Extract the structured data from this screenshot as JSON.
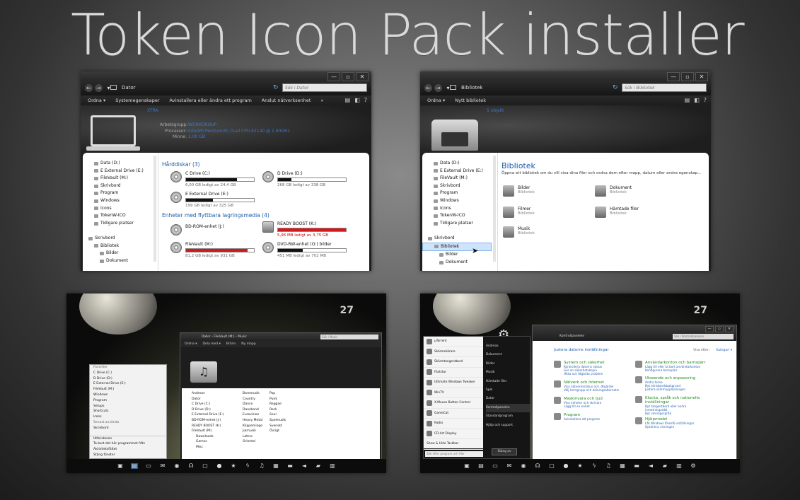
{
  "title": "Token Icon Pack installer",
  "explorer1": {
    "breadcrumb": "Dator",
    "search_placeholder": "Sök i Dator",
    "commands": [
      "Ordna ▾",
      "Systemegenskaper",
      "Avinstallera eller ändra ett program",
      "Anslut nätverksenhet",
      "»"
    ],
    "sys": {
      "computer_name": "XTRA",
      "workgroup_label": "Arbetsgrupp:",
      "workgroup": "WORKGROUP",
      "processor_label": "Processor:",
      "processor": "Intel(R) Pentium(R) Dual  CPU  E2140  @ 1.60GHz",
      "memory_label": "Minne:",
      "memory": "2,00 GB"
    },
    "nav": [
      "Data (D:)",
      "E External Drive (E:)",
      "FileVault (M:)",
      "Skrivbord",
      "Program",
      "Windows",
      "Icons",
      "TokenW-ICO",
      "Tidigare platser",
      "",
      "Skrivbord",
      "Bibliotek",
      "Bilder",
      "Dokument"
    ],
    "hdd_header": "Hårddiskar (3)",
    "removable_header": "Enheter med flyttbara lagringsmedia (4)",
    "drives": [
      {
        "name": "C Drive (C:)",
        "info": "6,00 GB ledigt av 24,4 GB",
        "fill": 0.75
      },
      {
        "name": "D Drive (D:)",
        "info": "268 GB ledigt av 338 GB",
        "fill": 0.2
      },
      {
        "name": "E External Drive (E:)",
        "info": "199 GB ledigt av 325 GB",
        "fill": 0.4
      }
    ],
    "removable": [
      {
        "name": "BD-ROM-enhet (J:)",
        "info": ""
      },
      {
        "name": "READY BOOST (K:)",
        "info": "5,96 MB ledigt av 3,75 GB",
        "fill": 1.0
      },
      {
        "name": "FileVault (M:)",
        "info": "81,2 GB ledigt av 931 GB",
        "fill": 0.91
      },
      {
        "name": "DVD-RW-enhet (O:) bilder",
        "info": "451 MB ledigt av 702 MB",
        "fill": 0.36
      }
    ]
  },
  "explorer2": {
    "breadcrumb": "Bibliotek",
    "search_placeholder": "Sök i Bibliotek",
    "commands": [
      "Ordna ▾",
      "Nytt bibliotek"
    ],
    "hero_label": "5 objekt",
    "nav": [
      "Data (D:)",
      "E External Drive (E:)",
      "FileVault (M:)",
      "Skrivbord",
      "Program",
      "Windows",
      "Icons",
      "TokenW-ICO",
      "Tidigare platser",
      "",
      "Skrivbord",
      "Bibliotek",
      "Bilder",
      "Dokument"
    ],
    "lib_title": "Bibliotek",
    "lib_desc": "Öppna ett bibliotek om du vill visa dina filer och ordna dem efter mapp, datum eller andra egenskap...",
    "libs": [
      {
        "name": "Bilder",
        "sub": "Bibliotek"
      },
      {
        "name": "Dokument",
        "sub": "Bibliotek"
      },
      {
        "name": "Filmer",
        "sub": "Bibliotek"
      },
      {
        "name": "Hämtade filer",
        "sub": "Bibliotek"
      },
      {
        "name": "Musik",
        "sub": "Bibliotek"
      }
    ]
  },
  "desktop1": {
    "clock": "27",
    "start_items": [
      "Favoriter",
      "C Drive (C:)",
      "D Drive (D:)",
      "E External Drive (E:)",
      "FileVault (M:)",
      "Windows",
      "Program",
      "Setups",
      "Shortcuts",
      "Icons",
      "Senast använda",
      "Skrivbord"
    ],
    "start_bottom": [
      "Utforskaren",
      "Ta bort det här programmet från Aktivitetsfältet",
      "Stäng fönster"
    ],
    "win": {
      "breadcrumb": "Dator › FileVault (M:) › Music",
      "search": "Sök i Music",
      "commands": [
        "Ordna ▾",
        "Dela med ▾",
        "Bränn",
        "Ny mapp"
      ],
      "col1": [
        "Andreas",
        "Dator",
        "C Drive (C:)",
        "D Drive (D:)",
        "E External Drive (E:)",
        "BD-ROM-enhet (J:)",
        "READY BOOST (K:)",
        "FileVault (M:)",
        "Downloads",
        "Games",
        "Misc"
      ],
      "col2": [
        "Barnmusik",
        "Country",
        "Dance",
        "Dansband",
        "Eurovision",
        "Heavy Metal",
        "Klippeminge",
        "Julmusik",
        "Latino",
        "Oriental"
      ],
      "col3": [
        "Pop",
        "Punk",
        "Reggae",
        "Rock",
        "Soul",
        "Spelmusik",
        "Svenskt",
        "Övrigt"
      ]
    }
  },
  "desktop2": {
    "clock": "27",
    "start_left": [
      "µTorrent",
      "Skärmskärare",
      "Skärmtangentbord",
      "Fäststar",
      "Ultimate Windows Tweaker",
      "WinTV",
      "X-Mouse Button Control",
      "GameCat",
      "Radio",
      "CD-Art Display",
      "Show & Hide Taskbar",
      "Alla program"
    ],
    "start_right": [
      "Andreas",
      "Dokument",
      "Bilder",
      "Musik",
      "Hämtade filer",
      "Spel",
      "Dator",
      "Kontrollpanelen",
      "Standardprogram",
      "Hjälp och support"
    ],
    "search_placeholder": "Sök efter program och filer",
    "shutdown": "Stäng av",
    "cp": {
      "title": "Justera datorns inställningar",
      "view": "Visa efter:",
      "view_value": "Kategori ▾",
      "breadcrumb": "Kontrollpanelen",
      "search": "Sök i Kontrollpanelen",
      "items": [
        {
          "h": "System och säkerhet",
          "l": [
            "Kontrollera datorns status",
            "Gör en säkerhetskopia",
            "Hitta och åtgärda problem"
          ]
        },
        {
          "h": "Användarkonton och barnspärr",
          "l": [
            "Lägg till eller ta bort användarkonton",
            "Konfigurera barnspärr"
          ]
        },
        {
          "h": "Nätverk och Internet",
          "l": [
            "Visa nätverksstatus och -åtgärder",
            "Välj hemgrupp och delningsalternativ"
          ]
        },
        {
          "h": "Utseende och anpassning",
          "l": [
            "Ändra tema",
            "Byt skrivbordsbakgrund",
            "Justera skärmupplösningen"
          ]
        },
        {
          "h": "Maskinvara och ljud",
          "l": [
            "Visa enheter och skrivare",
            "Lägg till en enhet"
          ]
        },
        {
          "h": "Klocka, språk och nationella inställningar",
          "l": [
            "Byt tangentbord eller andra inmatningssätt",
            "Byt visningsspråk"
          ]
        },
        {
          "h": "Program",
          "l": [
            "Avinstallera ett program"
          ]
        },
        {
          "h": "Hjälpmedel",
          "l": [
            "Låt Windows föreslå inställningar",
            "Optimera visningen"
          ]
        }
      ]
    }
  }
}
